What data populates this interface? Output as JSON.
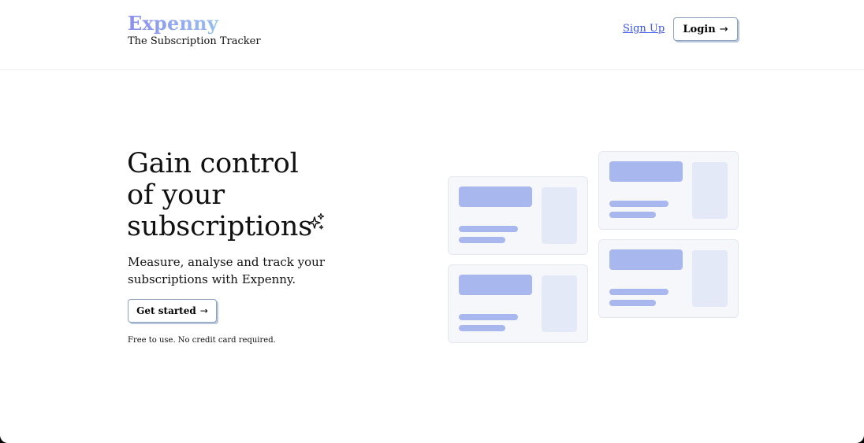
{
  "header": {
    "brand_name": "Expenny",
    "brand_tagline": "The Subscription Tracker",
    "signup_label": "Sign Up",
    "login_label": "Login",
    "login_arrow": "→"
  },
  "hero": {
    "title_lines": [
      "Gain control",
      "of your",
      "subscriptions"
    ],
    "subtitle": "Measure, analyse and track your subscriptions with Expenny.",
    "cta_label": "Get started",
    "cta_arrow": "→",
    "note": "Free to use. No credit card required."
  },
  "icons": {
    "sparkle": "sparkle-icon",
    "arrow": "arrow-right-icon"
  },
  "colors": {
    "brand_gradient": [
      "#8b8df0",
      "#97b6ef",
      "#7ee3df"
    ],
    "link": "#3b56e6",
    "placeholder_bar": "#a8b7ee",
    "placeholder_block": "#e4e9f7",
    "card_bg": "#f6f7fa"
  }
}
